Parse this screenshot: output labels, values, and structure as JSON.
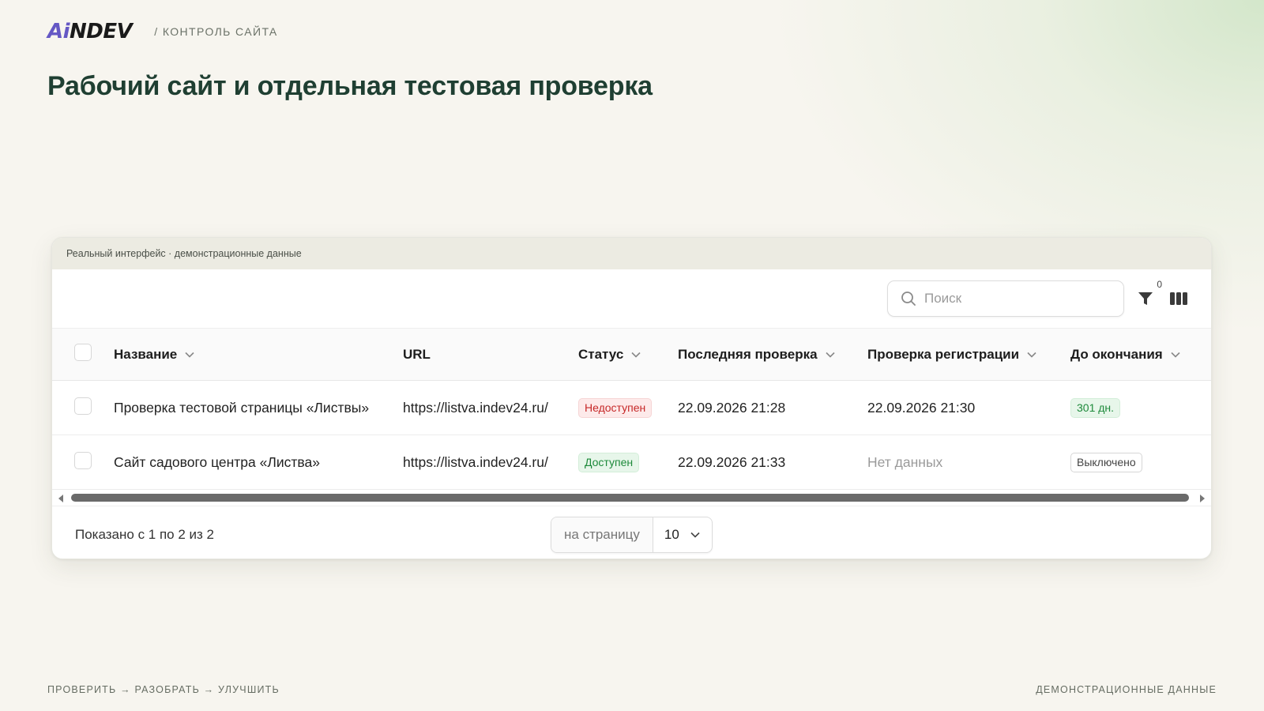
{
  "brand": {
    "logo_accent": "Ai",
    "logo_rest": "NDEV",
    "accent_color": "#6558c4"
  },
  "header": {
    "breadcrumb": "/ Контроль сайта"
  },
  "page": {
    "title": "Рабочий сайт и отдельная тестовая проверка"
  },
  "panel": {
    "caption": "Реальный интерфейс · демонстрационные данные",
    "search": {
      "placeholder": "Поиск",
      "value": ""
    },
    "filter_count": "0",
    "columns": [
      "Название",
      "URL",
      "Статус",
      "Последняя проверка",
      "Проверка регистрации",
      "До окончания"
    ],
    "rows": [
      {
        "name": "Проверка тестовой страницы «Листвы»",
        "url": "https://listva.indev24.ru/",
        "status": "Недоступен",
        "last_check": "22.09.2026 21:28",
        "reg_check": "22.09.2026 21:30",
        "remaining": "301 дн."
      },
      {
        "name": "Сайт садового центра «Листва»",
        "url": "https://listva.indev24.ru/",
        "status": "Доступен",
        "last_check": "22.09.2026 21:33",
        "reg_check": "Нет данных",
        "remaining": "Выключено"
      }
    ],
    "pagination": {
      "shown_text": "Показано с 1 по 2 из 2",
      "per_page_label": "на страницу",
      "per_page_value": "10"
    }
  },
  "footer": {
    "left": "Проверить → разобрать → улучшить",
    "right": "Демонстрационные данные"
  },
  "colors": {
    "status_down": "#c62828",
    "status_up": "#1e8a3b",
    "title": "#1f3f32"
  }
}
